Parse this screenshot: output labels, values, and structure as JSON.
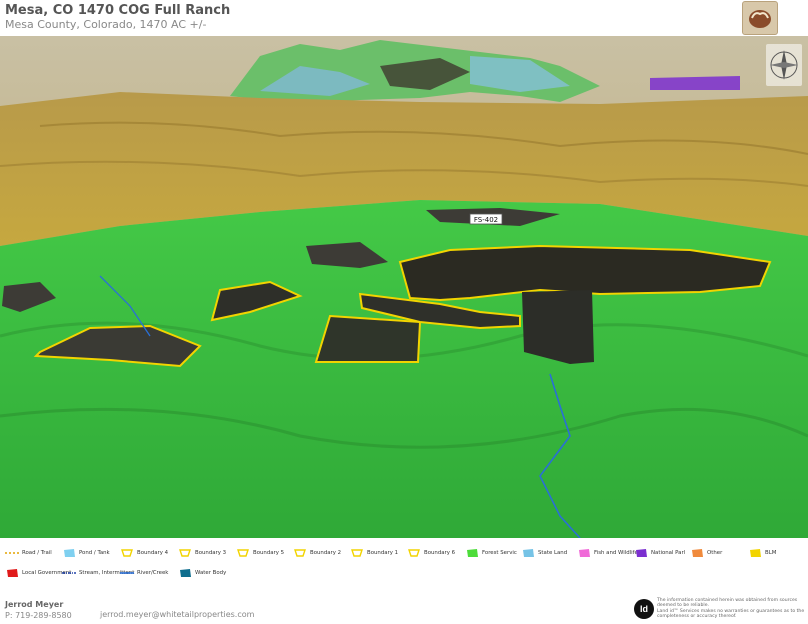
{
  "header": {
    "title": "Mesa, CO 1470 COG Full Ranch",
    "subtitle": "Mesa County, Colorado, 1470 AC +/-"
  },
  "map": {
    "road_labels": [
      "FS-402"
    ],
    "colors": {
      "forest": "#35c43c",
      "bluff": "#c8a23a",
      "boundary": "#f2d400",
      "water": "#1d6fd0",
      "state_land": "#76c3e6"
    }
  },
  "legend": [
    {
      "label": "Road / Trail",
      "icon": "dashed-line-icon",
      "color": "#e4a400"
    },
    {
      "label": "Pond / Tank",
      "icon": "pond-icon",
      "color": "#7fd0f0"
    },
    {
      "label": "Boundary 4",
      "icon": "boundary-icon",
      "color": "#f2d400"
    },
    {
      "label": "Boundary 3",
      "icon": "boundary-icon",
      "color": "#f2d400"
    },
    {
      "label": "Boundary 5",
      "icon": "boundary-icon",
      "color": "#f2d400"
    },
    {
      "label": "Boundary 2",
      "icon": "boundary-icon",
      "color": "#f2d400"
    },
    {
      "label": "Boundary 1",
      "icon": "boundary-icon",
      "color": "#f2d400"
    },
    {
      "label": "Boundary 6",
      "icon": "boundary-icon",
      "color": "#f2d400"
    },
    {
      "label": "Forest Servic",
      "icon": "polygon-icon",
      "color": "#4ddc3a"
    },
    {
      "label": "State Land",
      "icon": "polygon-icon",
      "color": "#76c3e6"
    },
    {
      "label": "Fish and Wildlife",
      "icon": "polygon-icon",
      "color": "#f06ad8"
    },
    {
      "label": "National Parl",
      "icon": "polygon-icon",
      "color": "#7b2fd0"
    },
    {
      "label": "Other",
      "icon": "polygon-icon",
      "color": "#f08a3c"
    },
    {
      "label": "BLM",
      "icon": "polygon-icon",
      "color": "#f2d400"
    },
    {
      "label": "Local Government",
      "icon": "polygon-icon",
      "color": "#e01a1a"
    },
    {
      "label": "Stream, Intermittent",
      "icon": "dashdot-line-icon",
      "color": "#2244aa"
    },
    {
      "label": "River/Creek",
      "icon": "line-icon",
      "color": "#2a6fd6"
    },
    {
      "label": "Water Body",
      "icon": "polygon-icon",
      "color": "#0f6e8e"
    }
  ],
  "footer": {
    "agent_name": "Jerrod Meyer",
    "phone": "P: 719-289-8580",
    "email": "jerrod.meyer@whitetailproperties.com",
    "brand_mark": "Id",
    "disclaimer_1": "The information contained herein was obtained from sources deemed to be reliable.",
    "disclaimer_2": "Land id™ Services makes no warranties or guarantees as to the completeness or accuracy thereof."
  }
}
